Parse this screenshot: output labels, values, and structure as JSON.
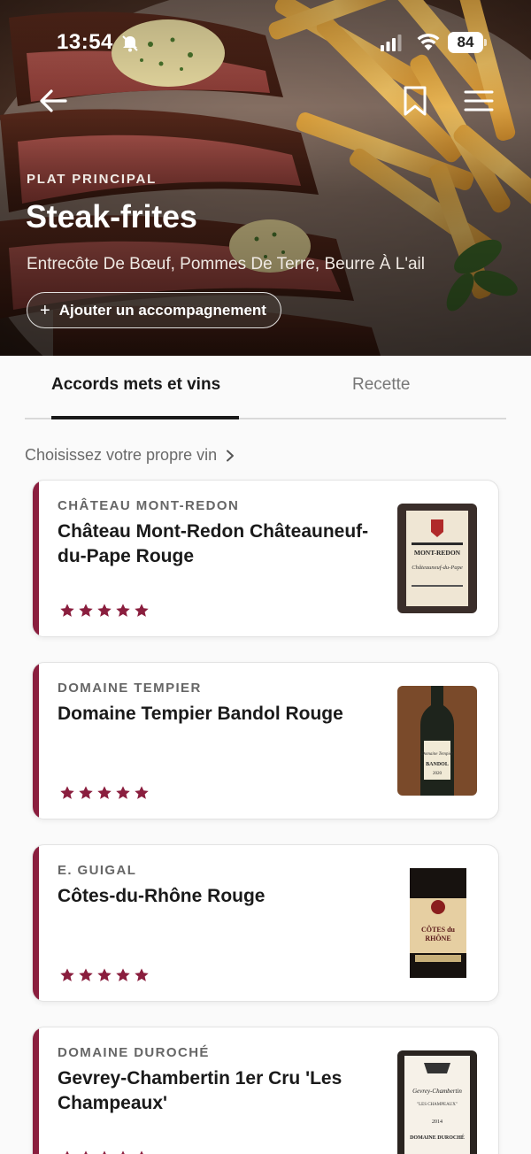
{
  "status_bar": {
    "time": "13:54",
    "battery": "84"
  },
  "hero": {
    "category": "PLAT PRINCIPAL",
    "title": "Steak-frites",
    "subtitle": "Entrecôte De Bœuf, Pommes De Terre, Beurre À L'ail",
    "add_button": "Ajouter un accompagnement"
  },
  "tabs": [
    {
      "label": "Accords mets et vins",
      "active": true
    },
    {
      "label": "Recette",
      "active": false
    }
  ],
  "choose_link": "Choisissez votre propre vin",
  "accent_color": "#8a1e3e",
  "wines": [
    {
      "producer": "CHÂTEAU MONT-REDON",
      "name": "Château Mont-Redon Châteauneuf-du-Pape Rouge",
      "rating": 5,
      "label_text": "CHATEAU MONT-REDON"
    },
    {
      "producer": "DOMAINE TEMPIER",
      "name": "Domaine Tempier Bandol Rouge",
      "rating": 5,
      "label_text": "BANDOL 2020"
    },
    {
      "producer": "E. GUIGAL",
      "name": "Côtes-du-Rhône Rouge",
      "rating": 5,
      "label_text": "CÔTES du RHÔNE"
    },
    {
      "producer": "DOMAINE DUROCHÉ",
      "name": "Gevrey-Chambertin 1er Cru 'Les Champeaux'",
      "rating": 5,
      "label_text": "DOMAINE DUROCHÉ 2014"
    }
  ]
}
